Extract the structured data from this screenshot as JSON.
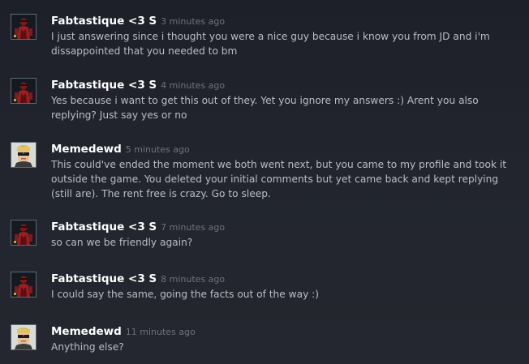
{
  "comments": [
    {
      "author": "Fabtastique <3 S",
      "time": "3 minutes ago",
      "avatar": "red-figure-avatar",
      "lines": [
        "I just answering since i thought you were a nice guy because i know you from JD and i'm",
        "dissappointed that you needed to bm"
      ]
    },
    {
      "author": "Fabtastique <3 S",
      "time": "4 minutes ago",
      "avatar": "red-figure-avatar",
      "lines": [
        "Yes because i want to get this out of they. Yet you ignore my answers :) Arent you also",
        "replying? Just say yes or no"
      ]
    },
    {
      "author": "Memedewd",
      "time": "5 minutes ago",
      "avatar": "blond-sunglasses-avatar",
      "lines": [
        "This could've ended the moment we both went next, but you came to my profile and took it",
        "outside the game. You deleted your initial comments but yet came back and kept replying",
        "(still are). The rent free is crazy. Go to sleep."
      ]
    },
    {
      "author": "Fabtastique <3 S",
      "time": "7 minutes ago",
      "avatar": "red-figure-avatar",
      "lines": [
        "so can we be friendly again?"
      ]
    },
    {
      "author": "Fabtastique <3 S",
      "time": "8 minutes ago",
      "avatar": "red-figure-avatar",
      "lines": [
        "I could say the same, going the facts out of the way :)"
      ]
    },
    {
      "author": "Memedewd",
      "time": "11 minutes ago",
      "avatar": "blond-sunglasses-avatar",
      "lines": [
        "Anything else?"
      ]
    }
  ]
}
